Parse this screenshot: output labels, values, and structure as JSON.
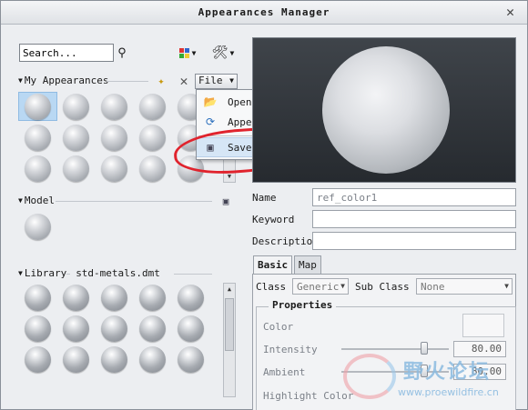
{
  "window": {
    "title": "Appearances Manager"
  },
  "search": {
    "value": "Search..."
  },
  "sections": {
    "my_appearances": "My Appearances",
    "model": "Model",
    "library": "Library",
    "library_file": "std-metals.dmt"
  },
  "file_menu": {
    "label": "File",
    "items": [
      {
        "label": "Open..."
      },
      {
        "label": "Append..."
      },
      {
        "label": "Save As..."
      }
    ]
  },
  "properties": {
    "name_label": "Name",
    "name_value": "ref_color1",
    "keyword_label": "Keyword",
    "keyword_value": "",
    "description_label": "Description",
    "description_value": ""
  },
  "tabs": [
    {
      "label": "Basic"
    },
    {
      "label": "Map"
    }
  ],
  "basic": {
    "class_label": "Class",
    "class_value": "Generic",
    "subclass_label": "Sub Class",
    "subclass_value": "None",
    "group_title": "Properties",
    "color_label": "Color",
    "intensity_label": "Intensity",
    "intensity_value": "80.00",
    "ambient_label": "Ambient",
    "ambient_value": "80.00",
    "highlight_label": "Highlight Color"
  },
  "watermark": {
    "cn": "野火论坛",
    "url": "www.proewildfire.cn"
  },
  "colors": {
    "selection": "#b9d8f3",
    "annotation": "#e0232d"
  }
}
